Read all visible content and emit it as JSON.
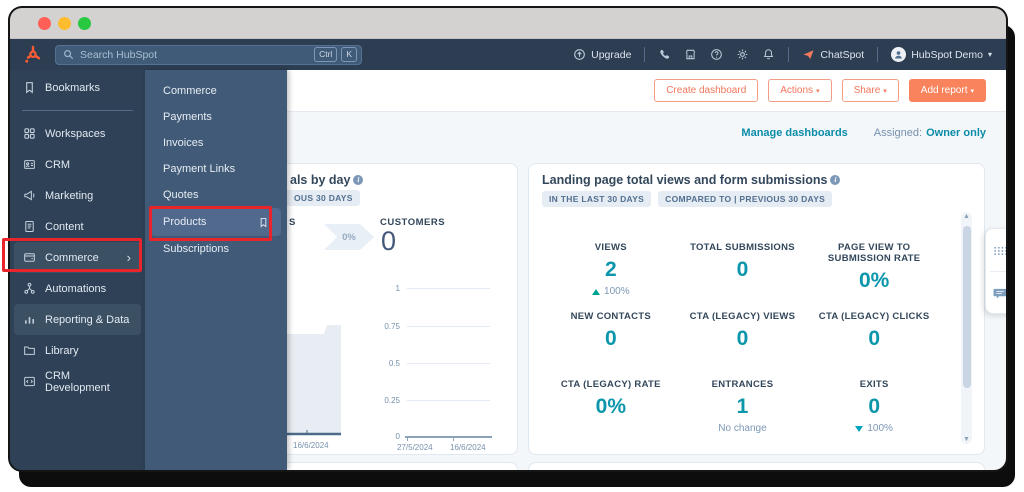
{
  "colors": {
    "brand_orange": "#ff5c35",
    "button_coral": "#f8835d",
    "teal_accent": "#0b96ab",
    "navy": "#33475b",
    "annotation_red": "#e9242b",
    "sidebar_bg": "#2e4156",
    "flyout_bg": "#405a77"
  },
  "topbar": {
    "search_placeholder": "Search HubSpot",
    "shortcut_ctrl": "Ctrl",
    "shortcut_k": "K",
    "upgrade": "Upgrade",
    "chatspot": "ChatSpot",
    "account": "HubSpot Demo"
  },
  "sidebar": {
    "items": [
      {
        "label": "Bookmarks"
      },
      {
        "label": "Workspaces"
      },
      {
        "label": "CRM"
      },
      {
        "label": "Marketing"
      },
      {
        "label": "Content"
      },
      {
        "label": "Commerce"
      },
      {
        "label": "Automations"
      },
      {
        "label": "Reporting & Data"
      },
      {
        "label": "Library"
      },
      {
        "label": "CRM Development"
      }
    ]
  },
  "flyout": {
    "items": [
      {
        "label": "Commerce"
      },
      {
        "label": "Payments"
      },
      {
        "label": "Invoices"
      },
      {
        "label": "Payment Links"
      },
      {
        "label": "Quotes"
      },
      {
        "label": "Products"
      },
      {
        "label": "Subscriptions"
      }
    ]
  },
  "header": {
    "create_dashboard": "Create dashboard",
    "actions": "Actions",
    "share": "Share",
    "add_report": "Add report"
  },
  "meta_row": {
    "manage_dashboards": "Manage dashboards",
    "assigned_label": "Assigned:",
    "assigned_value": "Owner only"
  },
  "left_card": {
    "title_fragment": "als by day",
    "badge_fragment": "OUS 30 DAYS",
    "funnel_label_fragment": "S",
    "funnel_percent": "0%",
    "customers_label": "CUSTOMERS",
    "customers_value": "0",
    "chart_left": {
      "x_label": "16/6/2024"
    },
    "chart_right": {
      "y_ticks": [
        "1",
        "0.75",
        "0.5",
        "0.25",
        "0"
      ],
      "x_labels": [
        "27/5/2024",
        "16/6/2024"
      ]
    }
  },
  "right_card": {
    "title": "Landing page total views and form submissions",
    "badge_primary": "IN THE LAST 30 DAYS",
    "badge_secondary": "COMPARED TO | PREVIOUS 30 DAYS",
    "metrics": [
      {
        "label": "VIEWS",
        "value": "2",
        "delta": "100%",
        "delta_dir": "up"
      },
      {
        "label": "TOTAL SUBMISSIONS",
        "value": "0"
      },
      {
        "label": "PAGE VIEW TO SUBMISSION RATE",
        "value": "0%"
      },
      {
        "label": "NEW CONTACTS",
        "value": "0"
      },
      {
        "label": "CTA (LEGACY) VIEWS",
        "value": "0"
      },
      {
        "label": "CTA (LEGACY) CLICKS",
        "value": "0"
      },
      {
        "label": "CTA (LEGACY) RATE",
        "value": "0%"
      },
      {
        "label": "ENTRANCES",
        "value": "1",
        "delta": "No change",
        "delta_dir": "none"
      },
      {
        "label": "EXITS",
        "value": "0",
        "delta": "100%",
        "delta_dir": "down"
      }
    ]
  }
}
